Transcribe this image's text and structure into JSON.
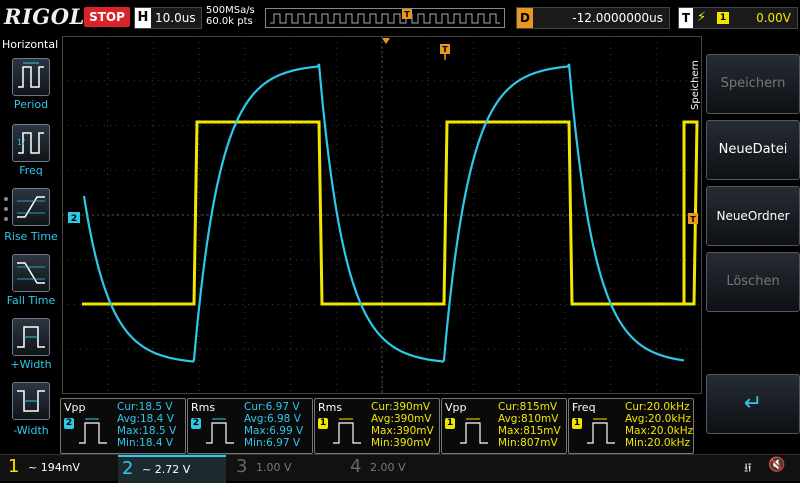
{
  "brand": "RIGOL",
  "run_state": "STOP",
  "horizontal": {
    "label": "H",
    "timebase": "10.0us",
    "sample_rate": "500MSa/s",
    "memory": "60.0k pts",
    "trigger_marker": "T"
  },
  "delay": {
    "label": "D",
    "value": "-12.0000000us"
  },
  "trigger": {
    "label": "T",
    "edge": "⚡",
    "source": "1",
    "level": "0.00V"
  },
  "left_menu": {
    "title": "Horizontal",
    "items": [
      {
        "label": "Period"
      },
      {
        "label": "Freq"
      },
      {
        "label": "Rise Time"
      },
      {
        "label": "Fall Time"
      },
      {
        "label": "+Width"
      },
      {
        "label": "-Width"
      }
    ]
  },
  "right_menu": {
    "title": "Speichern",
    "items": [
      {
        "label": "Speichern",
        "enabled": false
      },
      {
        "label": "NeueDatei",
        "enabled": true
      },
      {
        "label": "NeueOrdner",
        "enabled": true
      },
      {
        "label": "Löschen",
        "enabled": false
      },
      {
        "label": "↵",
        "enabled": true
      }
    ]
  },
  "markers": {
    "ch2_ref": "2",
    "trig_level": "T",
    "trig_pos": "T"
  },
  "measurements": [
    {
      "name": "Vpp",
      "channel": "2",
      "color": "#2ec8e8",
      "cur": "Cur:18.5 V",
      "avg": "Avg:18.4 V",
      "max": "Max:18.5 V",
      "min": "Min:18.4 V"
    },
    {
      "name": "Rms",
      "channel": "2",
      "color": "#2ec8e8",
      "cur": "Cur:6.97 V",
      "avg": "Avg:6.98 V",
      "max": "Max:6.99 V",
      "min": "Min:6.97 V"
    },
    {
      "name": "Rms",
      "channel": "1",
      "color": "#f2e600",
      "cur": "Cur:390mV",
      "avg": "Avg:390mV",
      "max": "Max:390mV",
      "min": "Min:390mV"
    },
    {
      "name": "Vpp",
      "channel": "1",
      "color": "#f2e600",
      "cur": "Cur:815mV",
      "avg": "Avg:810mV",
      "max": "Max:815mV",
      "min": "Min:807mV"
    },
    {
      "name": "Freq",
      "channel": "1",
      "color": "#f2e600",
      "cur": "Cur:20.0kHz",
      "avg": "Avg:20.0kHz",
      "max": "Max:20.0kHz",
      "min": "Min:20.0kHz"
    }
  ],
  "channels": [
    {
      "num": "1",
      "value": "~ 194mV",
      "color": "#f2e600",
      "active": true
    },
    {
      "num": "2",
      "value": "~ 2.72 V",
      "color": "#2ec8e8",
      "active": true
    },
    {
      "num": "3",
      "value": "1.00 V",
      "color": "#c040c0",
      "active": false
    },
    {
      "num": "4",
      "value": "2.00 V",
      "color": "#4060d0",
      "active": false
    }
  ],
  "status_icons": [
    "usb-icon",
    "speaker-muted-icon"
  ],
  "colors": {
    "ch1": "#f2e600",
    "ch2": "#2ec8e8",
    "trigger": "#e89820",
    "stop": "#d8232a"
  }
}
